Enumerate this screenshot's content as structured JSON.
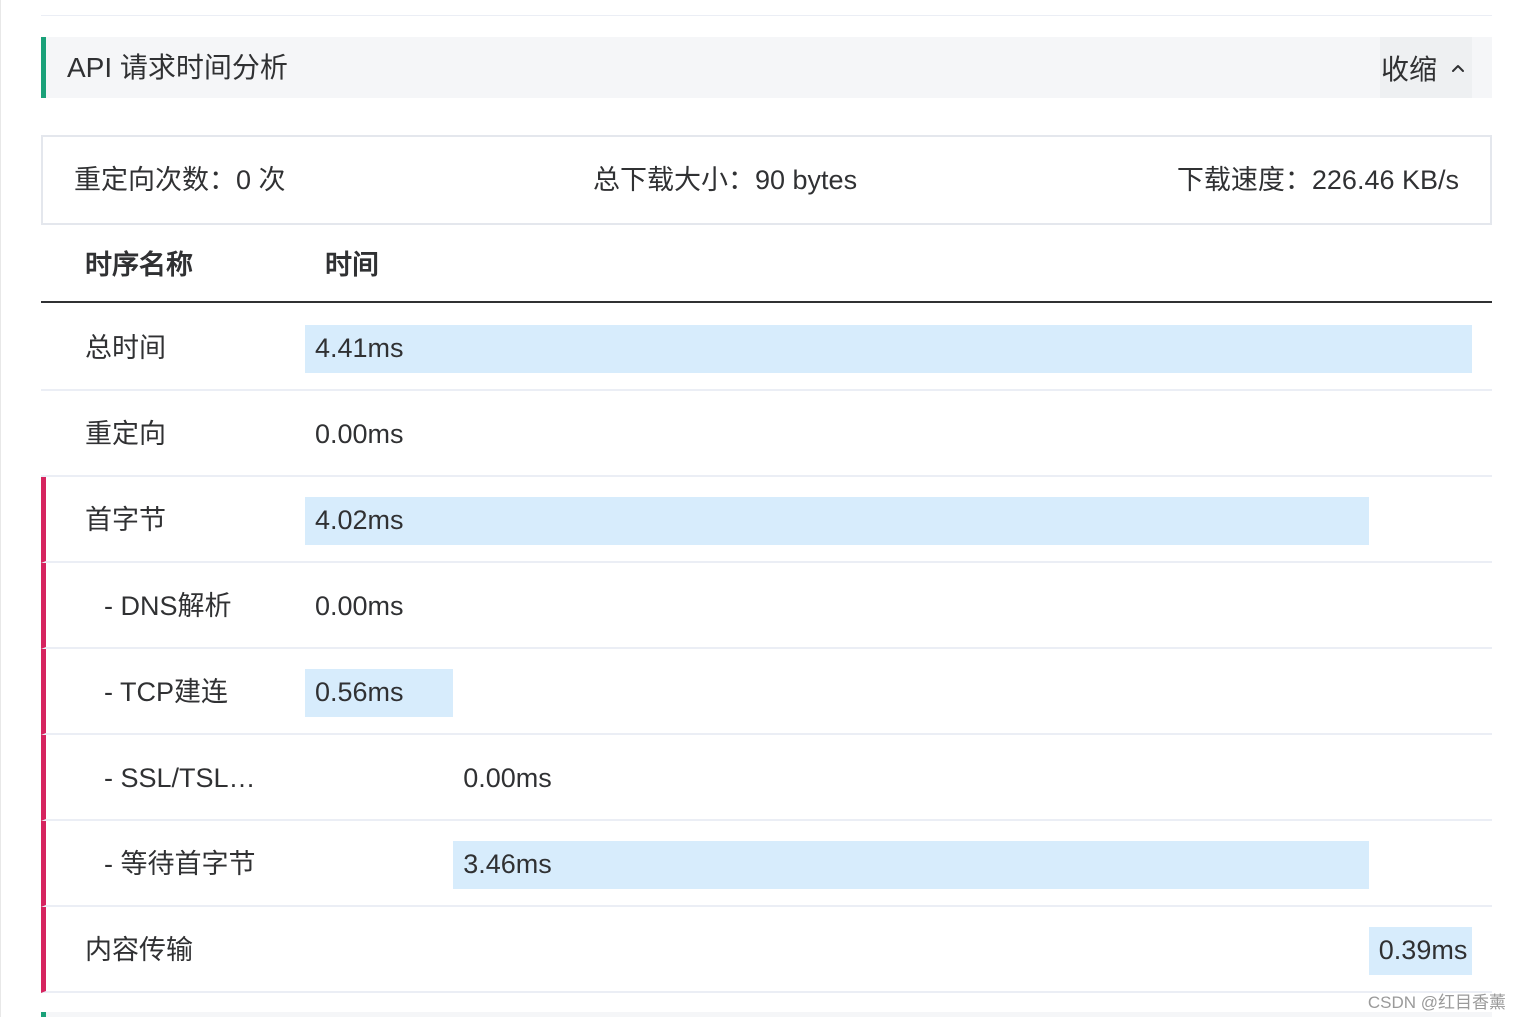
{
  "section": {
    "title": "API 请求时间分析",
    "collapse_label": "收缩",
    "colors": {
      "accent": "#1aa179",
      "marker": "#d6245f",
      "bar": "#d7ecfc"
    }
  },
  "summary": {
    "redirect_count": "重定向次数：0 次",
    "download_size": "总下载大小：90 bytes",
    "download_speed": "下载速度：226.46 KB/s"
  },
  "table": {
    "headers": {
      "name": "时序名称",
      "time": "时间"
    },
    "rows": [
      {
        "name": "总时间",
        "time": "4.41ms",
        "start_ms": 0.0,
        "duration_ms": 4.41,
        "marked": false,
        "sub": false
      },
      {
        "name": "重定向",
        "time": "0.00ms",
        "start_ms": 0.0,
        "duration_ms": 0.0,
        "marked": false,
        "sub": false
      },
      {
        "name": "首字节",
        "time": "4.02ms",
        "start_ms": 0.0,
        "duration_ms": 4.02,
        "marked": true,
        "sub": false
      },
      {
        "name": "- DNS解析",
        "time": "0.00ms",
        "start_ms": 0.0,
        "duration_ms": 0.0,
        "marked": true,
        "sub": true
      },
      {
        "name": "- TCP建连",
        "time": "0.56ms",
        "start_ms": 0.0,
        "duration_ms": 0.56,
        "marked": true,
        "sub": true
      },
      {
        "name": "- SSL/TSL…",
        "time": "0.00ms",
        "start_ms": 0.56,
        "duration_ms": 0.0,
        "marked": true,
        "sub": true
      },
      {
        "name": "- 等待首字节",
        "time": "3.46ms",
        "start_ms": 0.56,
        "duration_ms": 3.46,
        "marked": true,
        "sub": true
      },
      {
        "name": "内容传输",
        "time": "0.39ms",
        "start_ms": 4.02,
        "duration_ms": 0.39,
        "marked": true,
        "sub": false
      }
    ]
  },
  "watermark": "CSDN @红目香薰"
}
